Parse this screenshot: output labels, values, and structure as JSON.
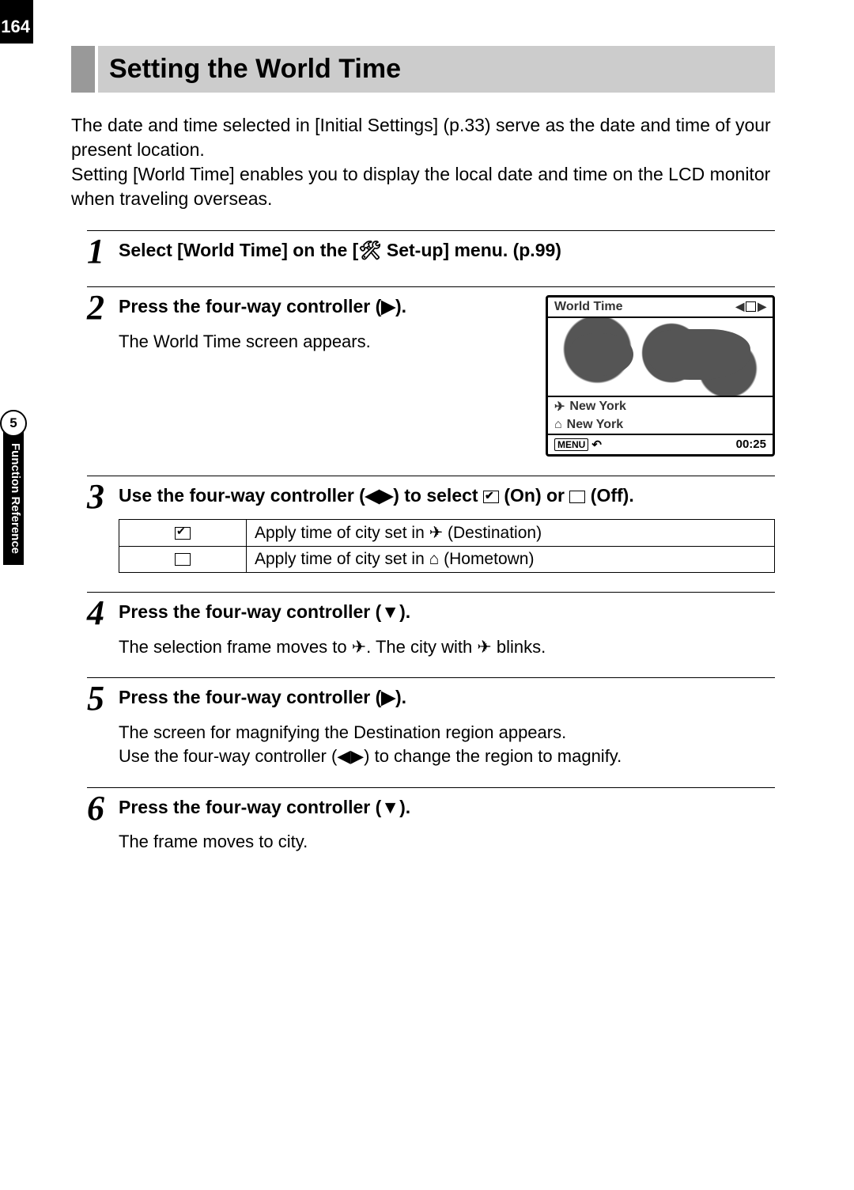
{
  "page_number": "164",
  "side_tab": {
    "chapter_number": "5",
    "label": "Function Reference"
  },
  "title": "Setting the World Time",
  "intro": "The date and time selected in [Initial Settings] (p.33) serve as the date and time of your present location.\nSetting [World Time] enables you to display the local date and time on the LCD monitor when traveling overseas.",
  "steps": {
    "s1": {
      "num": "1",
      "title": "Select [World Time] on the [🛠 Set-up] menu. (p.99)"
    },
    "s2": {
      "num": "2",
      "title": "Press the four-way controller (▶).",
      "desc": "The World Time screen appears."
    },
    "s3": {
      "num": "3",
      "title_pre": "Use the four-way controller (◀▶) to select ",
      "title_on": " (On) or ",
      "title_post": " (Off).",
      "table": {
        "row1": "Apply time of city set in ✈ (Destination)",
        "row2": "Apply time of city set in ⌂ (Hometown)"
      }
    },
    "s4": {
      "num": "4",
      "title": "Press the four-way controller (▼).",
      "desc": "The selection frame moves to ✈. The city with ✈ blinks."
    },
    "s5": {
      "num": "5",
      "title": "Press the four-way controller (▶).",
      "desc": "The screen for magnifying the Destination region appears.\nUse the four-way controller (◀▶) to change the region to magnify."
    },
    "s6": {
      "num": "6",
      "title": "Press the four-way controller (▼).",
      "desc": "The frame moves to city."
    }
  },
  "lcd": {
    "header": "World Time",
    "dest_city": "New York",
    "home_city": "New York",
    "menu_label": "MENU",
    "time": "00:25"
  }
}
